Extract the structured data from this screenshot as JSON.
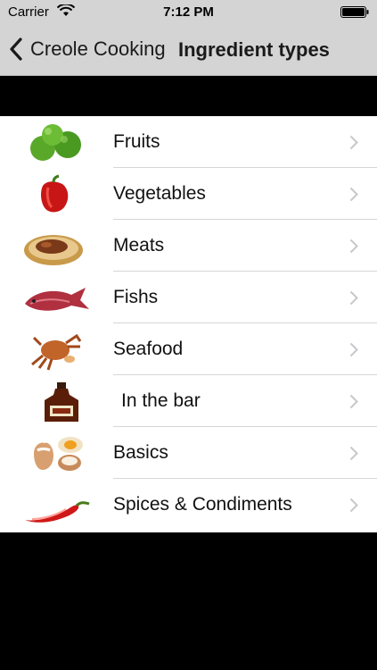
{
  "status_bar": {
    "carrier": "Carrier",
    "time": "7:12 PM",
    "wifi_icon": "wifi-icon",
    "battery_icon": "battery-icon"
  },
  "nav": {
    "back_label": "Creole Cooking",
    "title": "Ingredient types",
    "back_icon": "chevron-left-icon"
  },
  "items": [
    {
      "label": "Fruits",
      "icon": "limes-icon"
    },
    {
      "label": "Vegetables",
      "icon": "red-pepper-icon"
    },
    {
      "label": "Meats",
      "icon": "meat-plate-icon"
    },
    {
      "label": "Fishs",
      "icon": "red-fish-icon"
    },
    {
      "label": "Seafood",
      "icon": "crab-icon"
    },
    {
      "label": "In the bar",
      "icon": "rum-bottle-icon"
    },
    {
      "label": "Basics",
      "icon": "eggs-icon"
    },
    {
      "label": "Spices & Condiments",
      "icon": "chili-pepper-icon"
    }
  ],
  "colors": {
    "nav_background": "#d4d4d4",
    "page_background": "#000000",
    "list_background": "#ffffff",
    "separator": "#d6d6d6",
    "chevron": "#c7c7cc"
  }
}
